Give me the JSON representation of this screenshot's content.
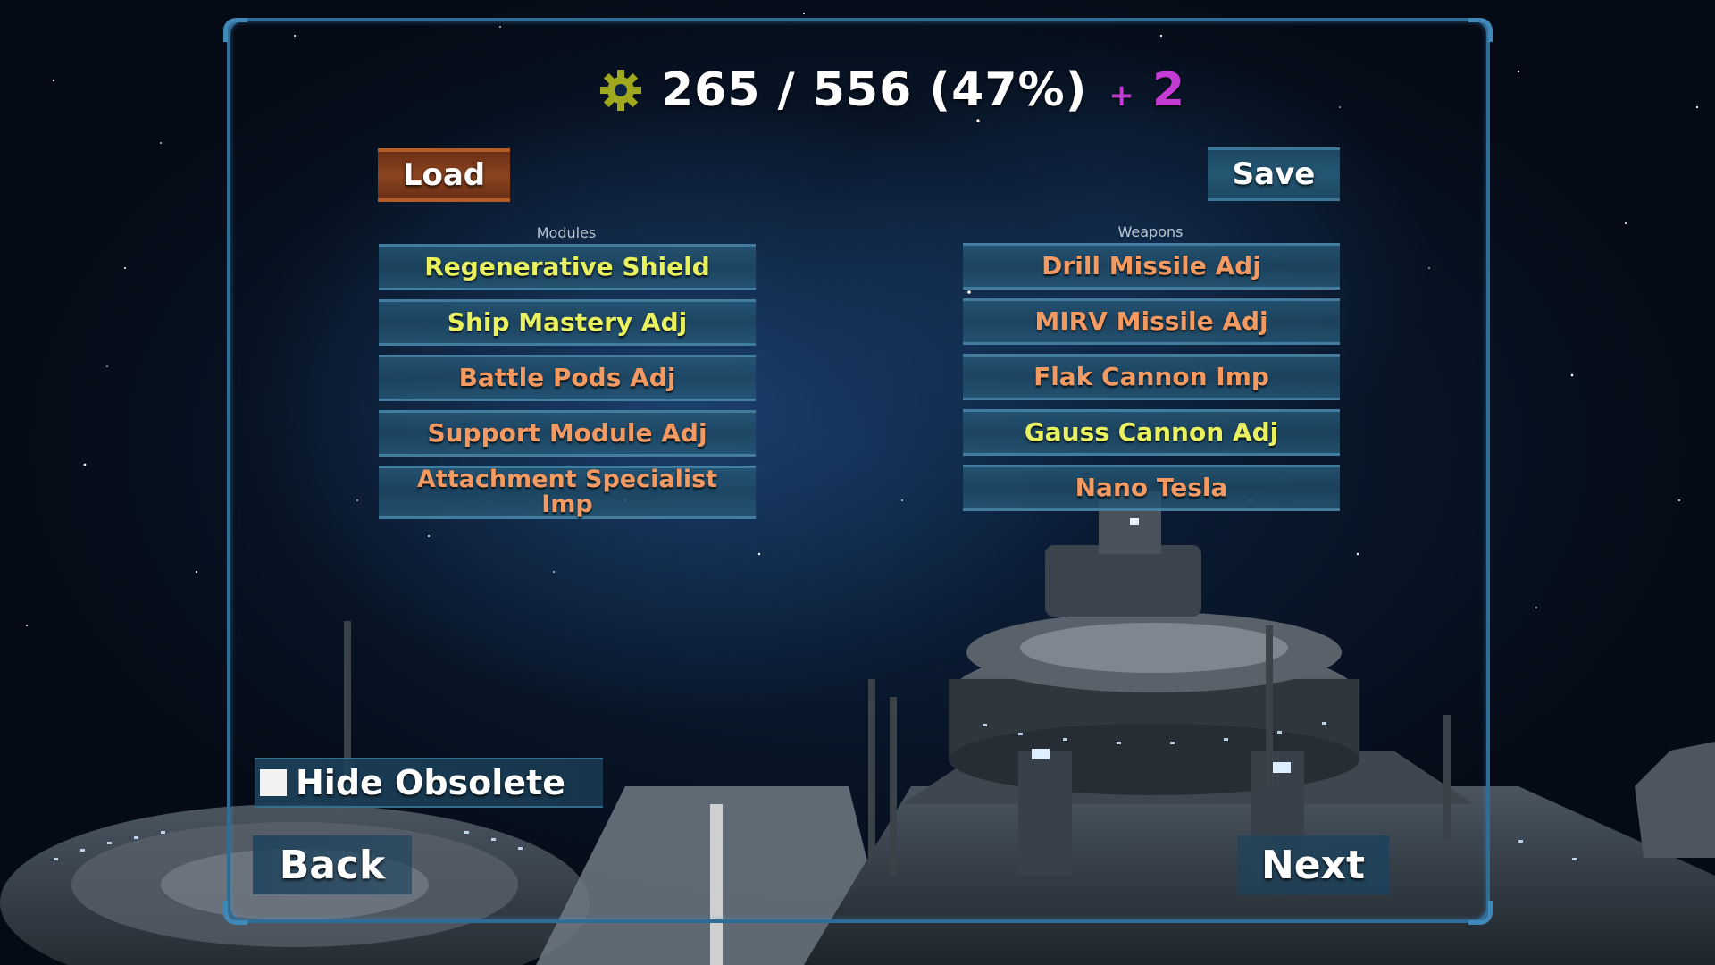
{
  "header": {
    "progress_text": "265 / 556 (47%)",
    "plus_symbol": "+",
    "bonus": "2",
    "icon": "gear-icon",
    "icon_color": "#a0a91e"
  },
  "buttons": {
    "load": "Load",
    "save": "Save",
    "back": "Back",
    "next": "Next"
  },
  "modules": {
    "title": "Modules",
    "items": [
      {
        "label": "Regenerative Shield",
        "color": "yellow"
      },
      {
        "label": "Ship Mastery Adj",
        "color": "yellow"
      },
      {
        "label": "Battle Pods Adj",
        "color": "orange"
      },
      {
        "label": "Support Module Adj",
        "color": "orange"
      },
      {
        "label": "Attachment Specialist Imp",
        "color": "orange"
      }
    ]
  },
  "weapons": {
    "title": "Weapons",
    "items": [
      {
        "label": "Drill Missile Adj",
        "color": "orange"
      },
      {
        "label": "MIRV Missile Adj",
        "color": "orange"
      },
      {
        "label": "Flak Cannon Imp",
        "color": "orange"
      },
      {
        "label": "Gauss Cannon Adj",
        "color": "yellow"
      },
      {
        "label": "Nano Tesla",
        "color": "orange"
      }
    ]
  },
  "filter": {
    "hide_obsolete_label": "Hide Obsolete",
    "hide_obsolete_checked": false
  },
  "colors": {
    "yellow_text": "#e9f25e",
    "orange_text": "#f39a62",
    "bonus": "#c43bd4",
    "load_button": "#8c4420",
    "panel": "#245773"
  }
}
